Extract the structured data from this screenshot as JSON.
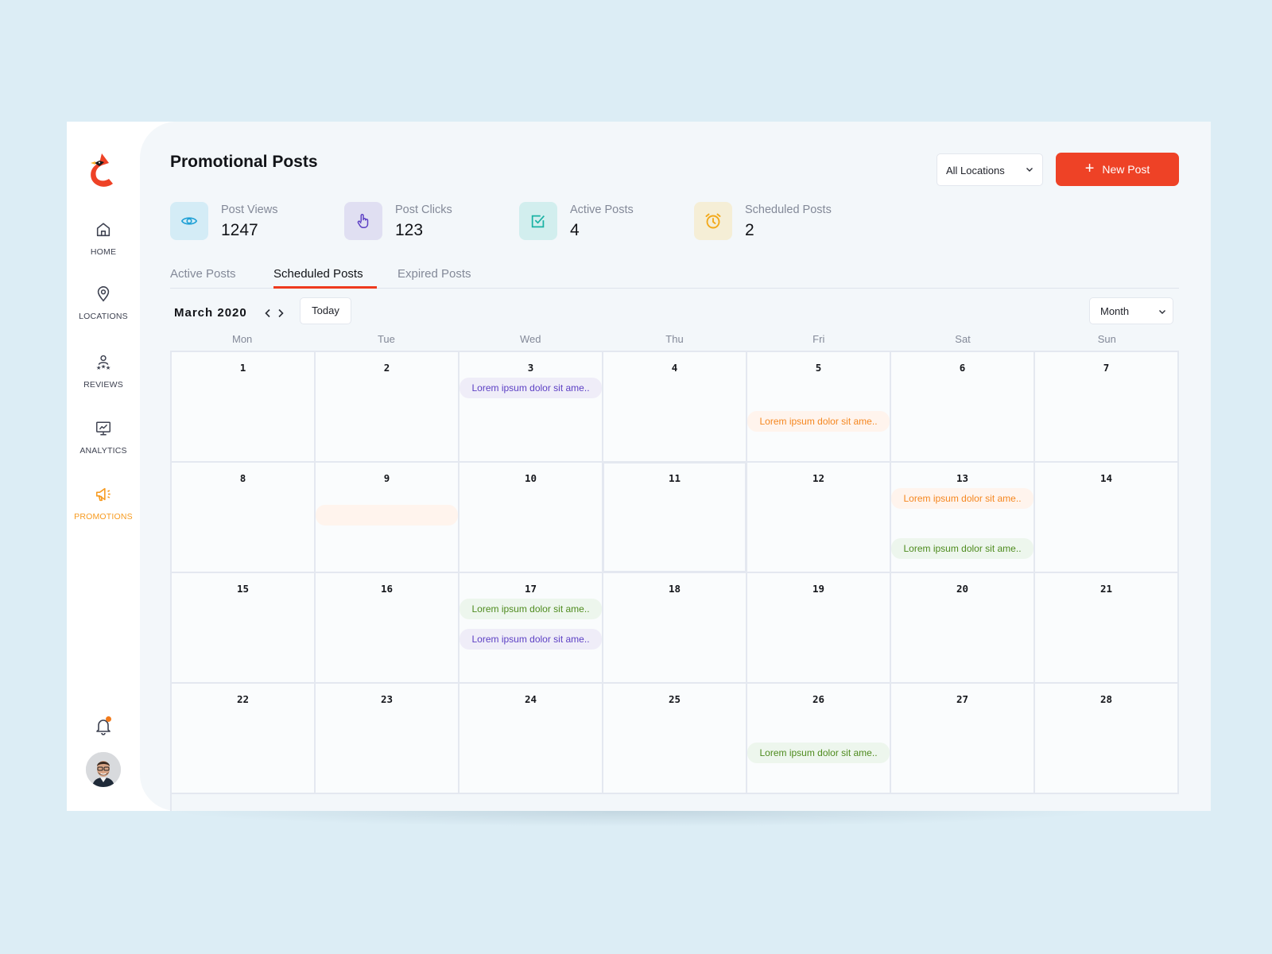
{
  "sidebar": {
    "items": [
      {
        "label": "HOME",
        "icon": "home-icon",
        "active": false
      },
      {
        "label": "LOCATIONS",
        "icon": "map-pin-icon",
        "active": false
      },
      {
        "label": "REVIEWS",
        "icon": "reviews-icon",
        "active": false
      },
      {
        "label": "ANALYTICS",
        "icon": "analytics-icon",
        "active": false
      },
      {
        "label": "PROMOTIONS",
        "icon": "megaphone-icon",
        "active": true
      }
    ],
    "notification_badge": true
  },
  "header": {
    "title": "Promotional Posts",
    "location_select": "All Locations",
    "new_post_label": "New Post"
  },
  "stats": [
    {
      "label": "Post Views",
      "value": "1247",
      "icon": "eye-icon",
      "bg": "#d4ecf6",
      "fg": "#1ea0d6"
    },
    {
      "label": "Post Clicks",
      "value": "123",
      "icon": "hand-pointer-icon",
      "bg": "#e0dff2",
      "fg": "#5c3fc4"
    },
    {
      "label": "Active Posts",
      "value": "4",
      "icon": "checkbox-icon",
      "bg": "#d2eeee",
      "fg": "#1ab2a4"
    },
    {
      "label": "Scheduled Posts",
      "value": "2",
      "icon": "alarm-clock-icon",
      "bg": "#f5eed6",
      "fg": "#f2a91c"
    }
  ],
  "tabs": [
    {
      "label": "Active Posts",
      "active": false
    },
    {
      "label": "Scheduled Posts",
      "active": true
    },
    {
      "label": "Expired Posts",
      "active": false
    }
  ],
  "calendar": {
    "month_label": "March 2020",
    "today_label": "Today",
    "view_select": "Month",
    "weekdays": [
      "Mon",
      "Tue",
      "Wed",
      "Thu",
      "Fri",
      "Sat",
      "Sun"
    ],
    "today_date": 11,
    "weeks": [
      [
        {
          "date": "1",
          "events": []
        },
        {
          "date": "2",
          "events": []
        },
        {
          "date": "3",
          "events": [
            {
              "text": "Lorem ipsum dolor sit ame..",
              "color": "purple",
              "slot": 0
            }
          ]
        },
        {
          "date": "4",
          "events": []
        },
        {
          "date": "5",
          "events": [
            {
              "text": "Lorem ipsum dolor sit ame..",
              "color": "orange",
              "slot": 2
            }
          ]
        },
        {
          "date": "6",
          "events": []
        },
        {
          "date": "7",
          "events": []
        }
      ],
      [
        {
          "date": "8",
          "events": []
        },
        {
          "date": "9",
          "events": [
            {
              "text": "",
              "color": "orange",
              "slot": 1
            }
          ]
        },
        {
          "date": "10",
          "events": []
        },
        {
          "date": "11",
          "events": []
        },
        {
          "date": "12",
          "events": []
        },
        {
          "date": "13",
          "events": [
            {
              "text": "Lorem ipsum dolor sit ame..",
              "color": "orange",
              "slot": 0
            },
            {
              "text": "Lorem ipsum dolor sit ame..",
              "color": "green",
              "slot": 3
            }
          ]
        },
        {
          "date": "14",
          "events": []
        }
      ],
      [
        {
          "date": "15",
          "events": []
        },
        {
          "date": "16",
          "events": []
        },
        {
          "date": "17",
          "events": [
            {
              "text": "Lorem ipsum dolor sit ame..",
              "color": "green",
              "slot": 0
            },
            {
              "text": "Lorem ipsum dolor sit ame..",
              "color": "purple",
              "slot": 1.8
            }
          ]
        },
        {
          "date": "18",
          "events": []
        },
        {
          "date": "19",
          "events": []
        },
        {
          "date": "20",
          "events": []
        },
        {
          "date": "21",
          "events": []
        }
      ],
      [
        {
          "date": "22",
          "events": []
        },
        {
          "date": "23",
          "events": []
        },
        {
          "date": "24",
          "events": []
        },
        {
          "date": "25",
          "events": []
        },
        {
          "date": "26",
          "events": [
            {
              "text": "Lorem ipsum dolor sit ame..",
              "color": "green",
              "slot": 2
            }
          ]
        },
        {
          "date": "27",
          "events": []
        },
        {
          "date": "28",
          "events": []
        }
      ]
    ]
  }
}
